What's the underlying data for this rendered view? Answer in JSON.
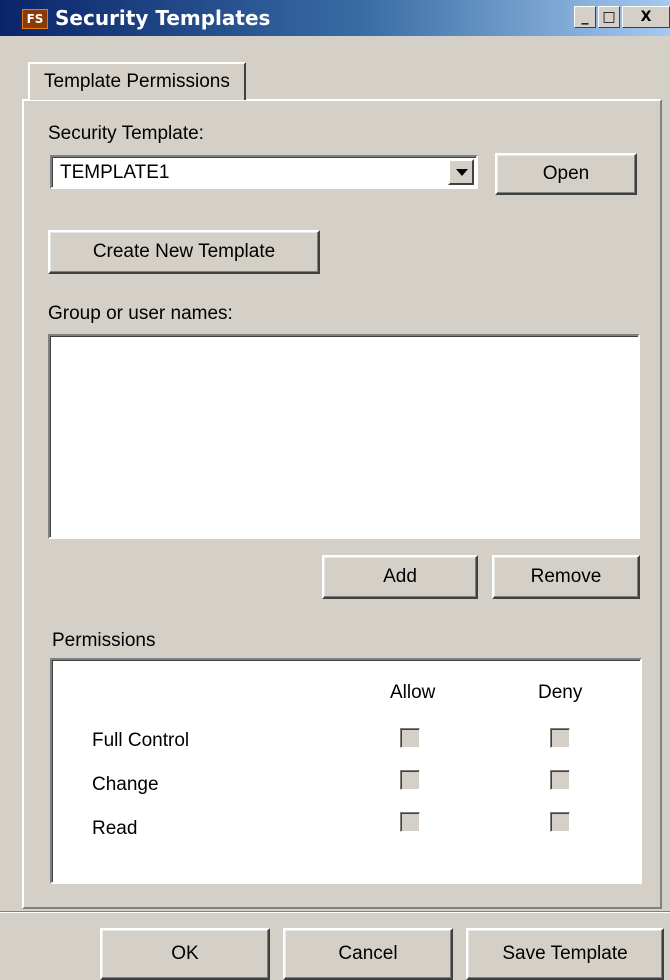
{
  "window": {
    "icon_text": "FS",
    "title": "Security Templates",
    "min_glyph": "_",
    "max_glyph": "□",
    "close_glyph": "X"
  },
  "tabs": [
    {
      "label": "Template Permissions"
    }
  ],
  "security_template": {
    "label": "Security Template:",
    "selected_value": "TEMPLATE1",
    "open_label": "Open",
    "create_label": "Create New Template"
  },
  "group_users": {
    "label": "Group or user names:",
    "items": [],
    "add_label": "Add",
    "remove_label": "Remove"
  },
  "permissions": {
    "label": "Permissions",
    "columns": {
      "allow": "Allow",
      "deny": "Deny"
    },
    "rows": [
      {
        "name": "Full Control",
        "allow": false,
        "deny": false
      },
      {
        "name": "Change",
        "allow": false,
        "deny": false
      },
      {
        "name": "Read",
        "allow": false,
        "deny": false
      }
    ]
  },
  "footer": {
    "ok_label": "OK",
    "cancel_label": "Cancel",
    "save_label": "Save Template"
  }
}
